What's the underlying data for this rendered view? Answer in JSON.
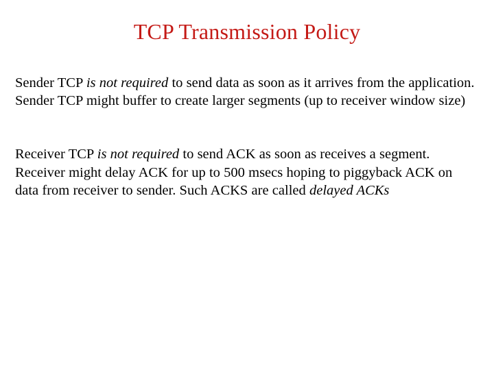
{
  "slide": {
    "title": "TCP Transmission Policy",
    "title_color": "#c41a16",
    "background_color": "#ffffff",
    "body_color": "#000000",
    "paragraphs": [
      {
        "id": "sender-policy",
        "runs": [
          {
            "text": "Sender TCP ",
            "style": "normal"
          },
          {
            "text": "is not required",
            "style": "italic"
          },
          {
            "text": " to send data as soon as it arrives from the application.",
            "style": "normal"
          },
          {
            "text": "\n",
            "style": "break"
          },
          {
            "text": "Sender TCP might buffer to create larger segments (up to receiver window size)",
            "style": "normal"
          }
        ],
        "plain_text": "Sender TCP is not required to send data as soon as it arrives from the application. Sender TCP might buffer to create larger segments (up to receiver window size)",
        "sentence_1_prefix": "Sender TCP ",
        "sentence_1_emphasis": "is not required",
        "sentence_1_suffix": " to send data as soon as it arrives from the application.",
        "sentence_2": "Sender TCP might buffer to create larger segments (up to receiver window size)"
      },
      {
        "id": "receiver-policy",
        "runs": [
          {
            "text": "Receiver TCP ",
            "style": "normal"
          },
          {
            "text": "is not required",
            "style": "italic"
          },
          {
            "text": " to send ACK as soon as receives a segment.",
            "style": "normal"
          },
          {
            "text": "\n",
            "style": "break"
          },
          {
            "text": "Receiver might delay ACK for up to 500 msecs hoping to piggyback ACK on data from receiver to sender. Such ACKS are called ",
            "style": "normal"
          },
          {
            "text": "delayed ACKs",
            "style": "italic"
          }
        ],
        "plain_text": "Receiver TCP is not required to send ACK as soon as receives a segment. Receiver might delay ACK for up to 500 msecs hoping to piggyback ACK on data from receiver to sender. Such ACKS are called delayed ACKs",
        "sentence_1_prefix": "Receiver TCP ",
        "sentence_1_emphasis": "is not required",
        "sentence_1_suffix": " to send ACK as soon as receives a segment.",
        "sentence_2_prefix": "Receiver might delay ACK for up to 500 msecs hoping to piggyback ACK on data from receiver to sender. Such ACKS are called ",
        "sentence_2_emphasis": "delayed ACKs",
        "delay_value": "500 msecs"
      }
    ]
  }
}
